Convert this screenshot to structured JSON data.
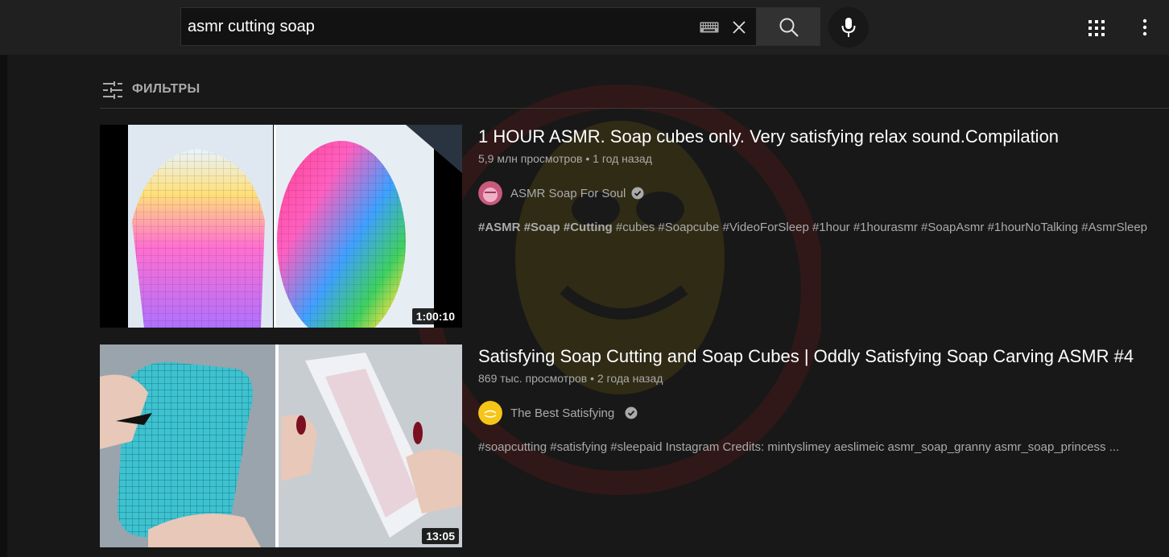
{
  "search": {
    "query": "asmr cutting soap"
  },
  "icons": {
    "keyboard": "keyboard-icon",
    "clear": "close-icon",
    "search": "search-icon",
    "mic": "microphone-icon",
    "apps": "apps-grid-icon",
    "more": "more-vert-icon",
    "filter": "tune-icon",
    "verified": "verified-check-icon"
  },
  "filters": {
    "label": "ФИЛЬТРЫ"
  },
  "results": [
    {
      "title": "1 HOUR ASMR. Soap cubes only. Very satisfying relax sound.Compilation",
      "views": "5,9 млн просмотров",
      "age": "1 год назад",
      "channel": "ASMR Soap For Soul",
      "description_bold": [
        "#ASMR",
        "#Soap",
        "#Cutting"
      ],
      "description_rest": "#cubes #Soapcube #VideoForSleep #1hour #1hourasmr #SoapAsmr #1hourNoTalking #AsmrSleep",
      "duration": "1:00:10"
    },
    {
      "title": "Satisfying Soap Cutting and Soap Cubes | Oddly Satisfying Soap Carving ASMR #4",
      "views": "869 тыс. просмотров",
      "age": "2 года назад",
      "channel": "The Best Satisfying",
      "description": "#soapcutting #satisfying #sleepaid Instagram Credits: mintyslimey aeslimeic asmr_soap_granny asmr_soap_princess ...",
      "duration": "13:05"
    }
  ],
  "colors": {
    "background": "#181818",
    "topbar": "#202020",
    "text_primary": "#ffffff",
    "text_secondary": "#aaaaaa"
  }
}
